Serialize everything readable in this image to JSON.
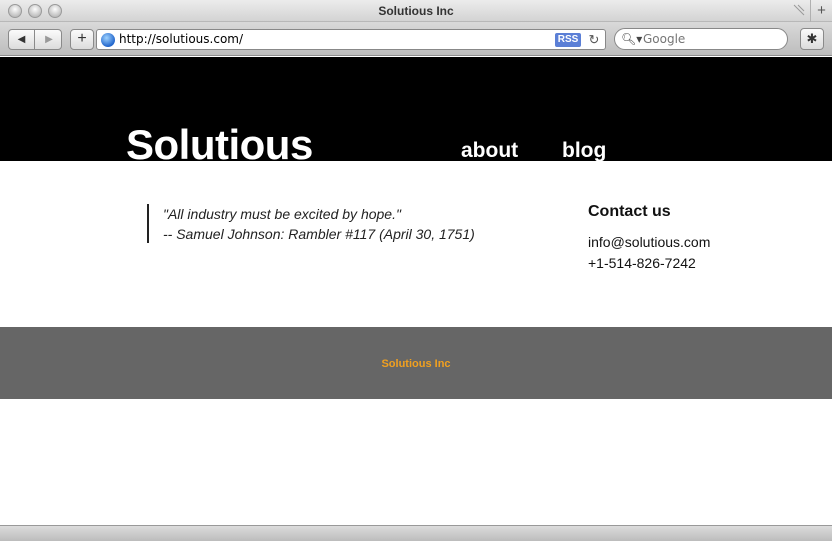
{
  "window": {
    "title": "Solutious Inc"
  },
  "toolbar": {
    "url": "http://solutious.com/",
    "rss_label": "RSS",
    "search_placeholder": "Google"
  },
  "site": {
    "logo": "Solutious",
    "nav": {
      "about": "about",
      "blog": "blog"
    },
    "quote": {
      "line1": "\"All industry must be excited by hope.\"",
      "line2": "-- Samuel Johnson: Rambler #117 (April 30, 1751)"
    },
    "contact": {
      "title": "Contact us",
      "email": "info@solutious.com",
      "phone": "+1-514-826-7242"
    },
    "footer": "Solutious Inc"
  },
  "colors": {
    "header_bg": "#000000",
    "footer_bg": "#666666",
    "footer_text": "#f0a020",
    "rss_badge": "#5b7fd6"
  }
}
